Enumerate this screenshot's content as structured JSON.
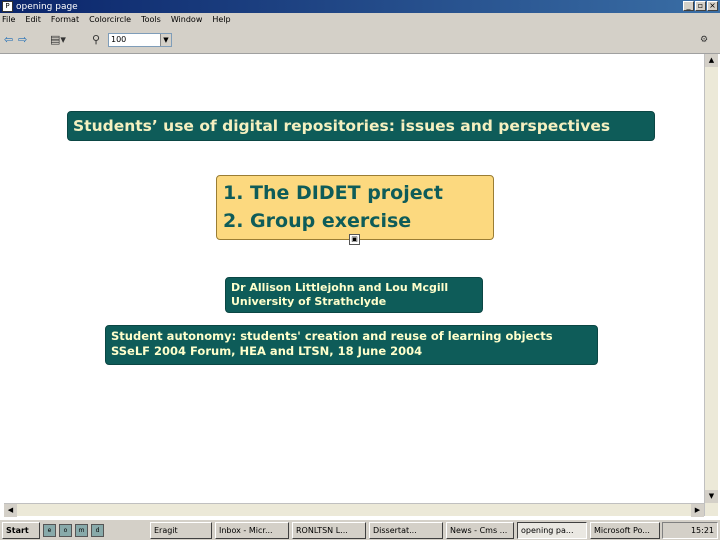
{
  "window": {
    "title": "opening page"
  },
  "menu": [
    "File",
    "Edit",
    "Format",
    "Colorcircle",
    "Tools",
    "Window",
    "Help"
  ],
  "toolbar": {
    "zoom": "100"
  },
  "slide": {
    "title": "Students’ use of digital repositories: issues and perspectives",
    "agenda": [
      "1. The DIDET project",
      "2. Group exercise"
    ],
    "authors_line1": "Dr Allison Littlejohn and Lou Mcgill",
    "authors_line2": "University of Strathclyde",
    "event_line1": "Student autonomy: students' creation and reuse of learning objects",
    "event_line2": "SSeLF 2004 Forum, HEA and LTSN, 18 June 2004"
  },
  "taskbar": {
    "start": "Start",
    "tasks": [
      "Eragit",
      "Inbox - Micr...",
      "RONLTSN L...",
      "Dissertat...",
      "News - Cms ...",
      "opening pa...",
      "Microsoft Po..."
    ],
    "clock": "15:21"
  }
}
